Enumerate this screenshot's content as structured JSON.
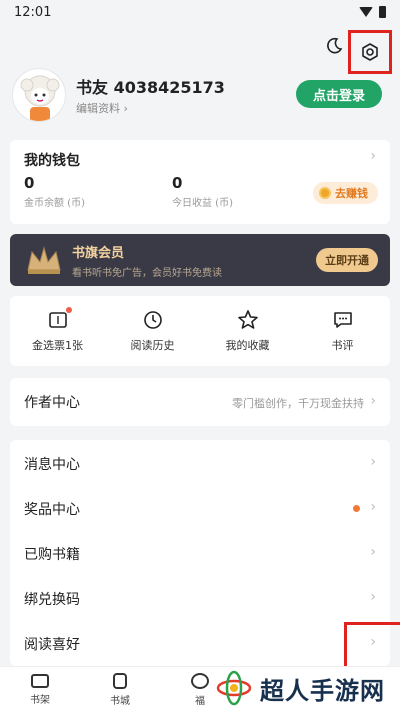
{
  "status_bar": {
    "time": "12:01"
  },
  "profile": {
    "nickname": "书友 4038425173",
    "edit_label": "编辑资料 ›",
    "login_button": "点击登录"
  },
  "wallet": {
    "title": "我的钱包",
    "coin_balance": "0",
    "coin_label": "金币余额 (币)",
    "today_earnings": "0",
    "today_label": "今日收益 (币)",
    "earn_button": "去赚钱"
  },
  "vip": {
    "title": "书旗会员",
    "subtitle": "看书听书免广告，会员好书免费读",
    "button": "立即开通"
  },
  "quick_actions": [
    {
      "label": "金选票1张",
      "icon": "ticket-icon",
      "has_dot": true
    },
    {
      "label": "阅读历史",
      "icon": "clock-icon"
    },
    {
      "label": "我的收藏",
      "icon": "star-icon"
    },
    {
      "label": "书评",
      "icon": "comment-icon"
    }
  ],
  "author_center": {
    "label": "作者中心",
    "tagline": "零门槛创作，千万现金扶持"
  },
  "menu": [
    {
      "label": "消息中心"
    },
    {
      "label": "奖品中心",
      "dot_color": "#ef7a36"
    },
    {
      "label": "已购书籍"
    },
    {
      "label": "绑兑换码"
    },
    {
      "label": "阅读喜好"
    }
  ],
  "tabs": [
    {
      "label": "书架",
      "icon": "bookshelf-icon"
    },
    {
      "label": "书城",
      "icon": "bookstore-icon"
    },
    {
      "label": "福",
      "icon": "welfare-icon"
    }
  ],
  "watermark": {
    "text": "超人手游网"
  },
  "colors": {
    "accent_green": "#22a466",
    "highlight_red": "#e0221e",
    "vip_gold": "#f0c98e"
  }
}
